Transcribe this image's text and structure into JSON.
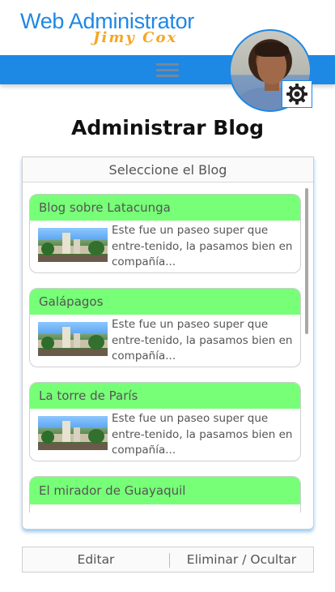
{
  "brand": {
    "name": "Web Administrator",
    "owner": "Jimy Cox"
  },
  "header": {
    "menu_icon": "hamburger-menu-icon",
    "settings_icon": "gear-icon",
    "accent_color": "#1e88e5"
  },
  "page": {
    "title": "Administrar Blog"
  },
  "blog_panel": {
    "header": "Seleccione el Blog",
    "items": [
      {
        "title": "Blog sobre Latacunga",
        "excerpt": "Este fue un paseo super que entre-tenido, la pasamos bien en compañía..."
      },
      {
        "title": "Galápagos",
        "excerpt": "Este fue un paseo super que entre-tenido, la pasamos bien en compañía..."
      },
      {
        "title": "La torre de París",
        "excerpt": "Este fue un paseo super que entre-tenido, la pasamos bien en compañía..."
      },
      {
        "title": "El mirador de Guayaquil",
        "excerpt": ""
      }
    ],
    "card_title_color": "#77ff77"
  },
  "actions": {
    "edit_label": "Editar",
    "delete_label": "Eliminar / Ocultar"
  }
}
